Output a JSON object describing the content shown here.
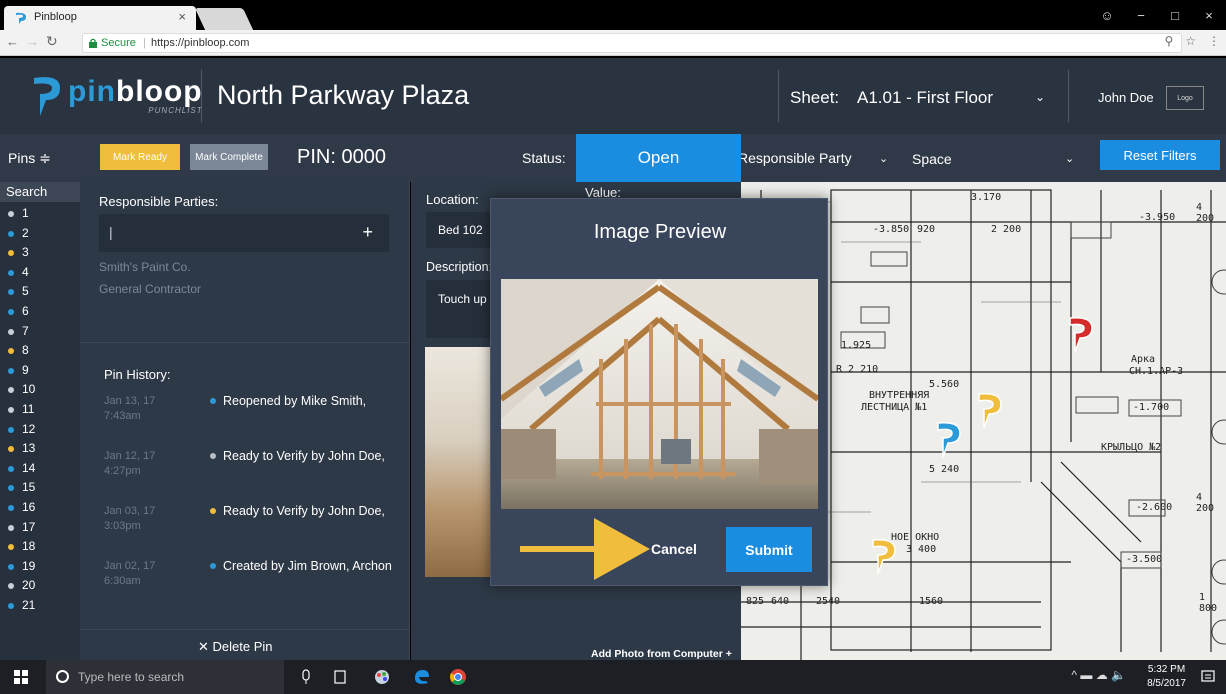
{
  "browser": {
    "tab_title": "Pinbloop",
    "tab_close": "×",
    "secure_label": "Secure",
    "url_separator": "|",
    "url": "https://pinbloop.com",
    "controls": [
      "−",
      "□",
      "×"
    ]
  },
  "header": {
    "brand_part1": "pin",
    "brand_part2": "bloop",
    "brand_tagline": "PUNCHLIST",
    "project_title": "North Parkway Plaza",
    "sheet_label": "Sheet:",
    "sheet_value": "A1.01 - First Floor",
    "user_name": "John Doe",
    "user_logo": "Logo"
  },
  "toolbar": {
    "pins_label": "Pins ≑",
    "mark_ready": "Mark Ready",
    "mark_complete": "Mark Complete",
    "pin_label": "PIN:  0000",
    "status_label": "Status:",
    "status_value": "Open",
    "filter_party": "Responsible Party",
    "filter_space": "Space",
    "reset_filters": "Reset Filters"
  },
  "sidebar": {
    "search_label": "Search",
    "pins": [
      {
        "num": "1",
        "color": "#c9cfd8"
      },
      {
        "num": "2",
        "color": "#2d9ad8"
      },
      {
        "num": "3",
        "color": "#f0bd3c"
      },
      {
        "num": "4",
        "color": "#2d9ad8"
      },
      {
        "num": "5",
        "color": "#2d9ad8"
      },
      {
        "num": "6",
        "color": "#2d9ad8"
      },
      {
        "num": "7",
        "color": "#c9cfd8"
      },
      {
        "num": "8",
        "color": "#f0bd3c"
      },
      {
        "num": "9",
        "color": "#2d9ad8"
      },
      {
        "num": "10",
        "color": "#c9cfd8"
      },
      {
        "num": "11",
        "color": "#c9cfd8"
      },
      {
        "num": "12",
        "color": "#2d9ad8"
      },
      {
        "num": "13",
        "color": "#f0bd3c"
      },
      {
        "num": "14",
        "color": "#2d9ad8"
      },
      {
        "num": "15",
        "color": "#2d9ad8"
      },
      {
        "num": "16",
        "color": "#2d9ad8"
      },
      {
        "num": "17",
        "color": "#c9cfd8"
      },
      {
        "num": "18",
        "color": "#f0bd3c"
      },
      {
        "num": "19",
        "color": "#2d9ad8"
      },
      {
        "num": "20",
        "color": "#c9cfd8"
      },
      {
        "num": "21",
        "color": "#2d9ad8"
      }
    ]
  },
  "details": {
    "responsible_title": "Responsible Parties:",
    "responsible_caret": "|",
    "responsible_add": "+",
    "responsible_items": [
      "Smith's Paint Co.",
      "General Contractor"
    ],
    "history_title": "Pin History:",
    "history": [
      {
        "date": "Jan 13, 17",
        "time": "7:43am",
        "text": "Reopened by Mike Smith,",
        "color": "#2d9ad8"
      },
      {
        "date": "Jan 12, 17",
        "time": "4:27pm",
        "text": "Ready to Verify by John Doe,",
        "color": "#b8bfc8"
      },
      {
        "date": "Jan 03, 17",
        "time": "3:03pm",
        "text": "Ready to Verify by John Doe,",
        "color": "#f0bd3c"
      },
      {
        "date": "Jan 02, 17",
        "time": "6:30am",
        "text": "Created by Jim Brown, Archon",
        "color": "#2d9ad8"
      }
    ],
    "delete_pin": "✕  Delete Pin"
  },
  "middle": {
    "location_label": "Location:",
    "value_label": "Value:",
    "location_value": "Bed 102",
    "description_label": "Description:",
    "description_value": "Touch up",
    "add_photo": "Add Photo from Computer +"
  },
  "modal": {
    "title": "Image Preview",
    "cancel": "Cancel",
    "submit": "Submit"
  },
  "blueprint": {
    "labels": [
      "3.170",
      "4 200",
      "-3.950",
      "-3.850",
      "920",
      "2 200",
      "1.925",
      "R 2 210",
      "5.560",
      "ВНУТРЕННЯЯ",
      "ЛЕСТНИЦА №1",
      "Арка",
      "СН.1.АР-3",
      "-1.700",
      "5 240",
      "КРЫЛЬЦО №2",
      "-2.600",
      "4 200",
      "НОЕ ОКНО",
      "3 400",
      "-3.500",
      "2540",
      "1560",
      "825",
      "640",
      "1 800"
    ],
    "markers": [
      {
        "color": "#d42b2b"
      },
      {
        "color": "#f0bd3c"
      },
      {
        "color": "#2d9ad8"
      },
      {
        "color": "#f0bd3c"
      }
    ]
  },
  "taskbar": {
    "search_placeholder": "Type here to search",
    "tray": "^  ▬  ☁  🔈",
    "time": "5:32 PM",
    "date": "8/5/2017"
  },
  "colors": {
    "accent_blue": "#1a8de0",
    "accent_yellow": "#f0bd3c",
    "panel": "#2e3947",
    "header": "#2a3340"
  }
}
